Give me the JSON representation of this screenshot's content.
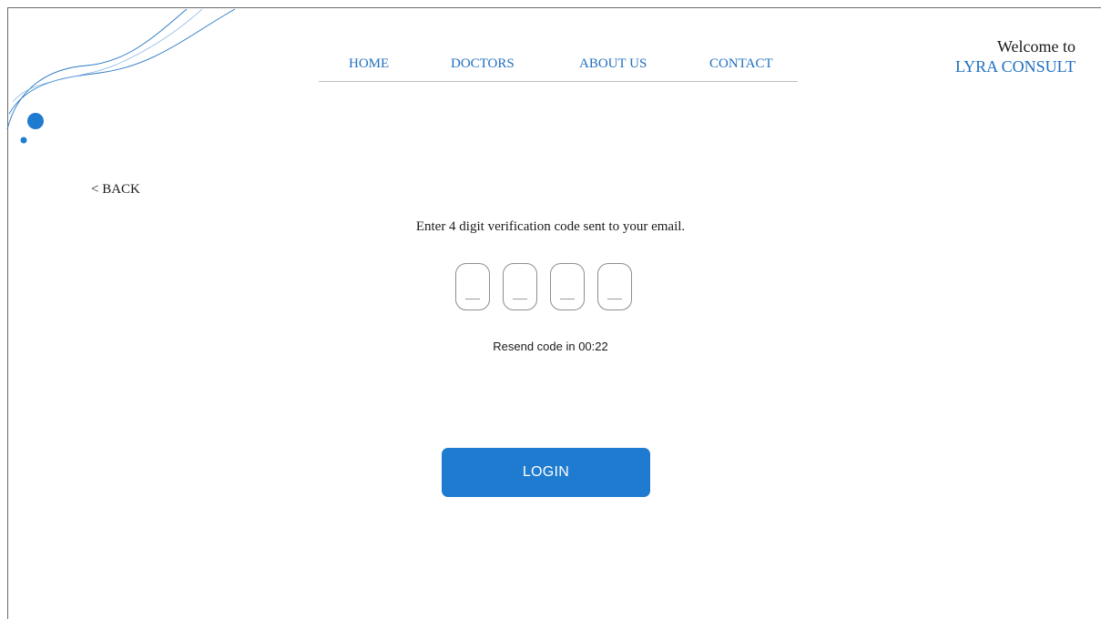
{
  "nav": {
    "items": [
      {
        "label": "HOME"
      },
      {
        "label": "DOCTORS"
      },
      {
        "label": "ABOUT US"
      },
      {
        "label": "CONTACT"
      }
    ]
  },
  "brand": {
    "welcome": "Welcome to",
    "name": "LYRA CONSULT"
  },
  "back_label": "< BACK",
  "verification": {
    "instruction": "Enter 4 digit verification code sent to your email.",
    "code_digits": [
      "",
      "",
      "",
      ""
    ],
    "resend_text": "Resend code in 00:22"
  },
  "login_label": "LOGIN",
  "colors": {
    "accent": "#1f7bd0",
    "link": "#1f6fc0",
    "border": "#8e8e8e"
  }
}
